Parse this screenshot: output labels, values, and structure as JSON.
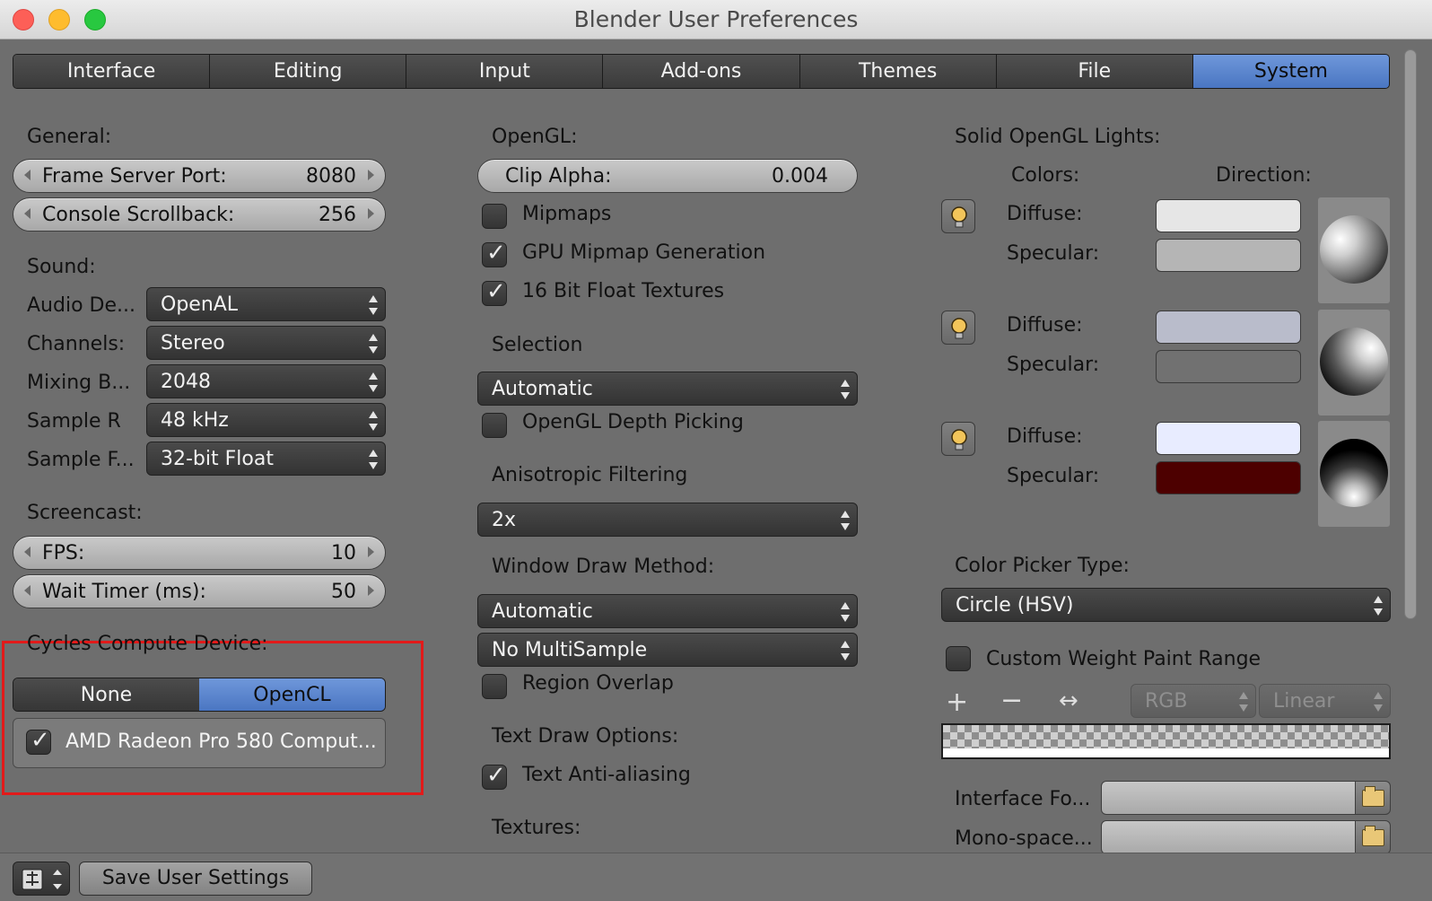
{
  "window": {
    "title": "Blender User Preferences"
  },
  "tabs": [
    {
      "label": "Interface"
    },
    {
      "label": "Editing"
    },
    {
      "label": "Input"
    },
    {
      "label": "Add-ons"
    },
    {
      "label": "Themes"
    },
    {
      "label": "File"
    },
    {
      "label": "System"
    }
  ],
  "active_tab": "System",
  "general": {
    "heading": "General:",
    "frame_server_port": {
      "label": "Frame Server Port:",
      "value": "8080"
    },
    "console_scrollback": {
      "label": "Console Scrollback:",
      "value": "256"
    }
  },
  "sound": {
    "heading": "Sound:",
    "rows": [
      {
        "label": "Audio De...",
        "value": "OpenAL"
      },
      {
        "label": "Channels:",
        "value": "Stereo"
      },
      {
        "label": "Mixing B...",
        "value": "2048"
      },
      {
        "label": "Sample R",
        "value": "48 kHz"
      },
      {
        "label": "Sample F...",
        "value": "32-bit Float"
      }
    ]
  },
  "screencast": {
    "heading": "Screencast:",
    "fps": {
      "label": "FPS:",
      "value": "10"
    },
    "wait_timer": {
      "label": "Wait Timer (ms):",
      "value": "50"
    }
  },
  "cycles": {
    "heading": "Cycles Compute Device:",
    "options": [
      "None",
      "OpenCL"
    ],
    "selected": "OpenCL",
    "device_label": "AMD Radeon Pro 580 Comput...",
    "device_checked": true
  },
  "opengl": {
    "heading": "OpenGL:",
    "clip_alpha": {
      "label": "Clip Alpha:",
      "value": "0.004"
    },
    "mipmaps": {
      "label": "Mipmaps",
      "checked": false
    },
    "gpu_mipmap": {
      "label": "GPU Mipmap Generation",
      "checked": true
    },
    "float_textures": {
      "label": "16 Bit Float Textures",
      "checked": true
    }
  },
  "selection": {
    "heading": "Selection",
    "value": "Automatic",
    "depth_picking": {
      "label": "OpenGL Depth Picking",
      "checked": false
    }
  },
  "anisotropic": {
    "heading": "Anisotropic Filtering",
    "value": "2x"
  },
  "window_draw": {
    "heading": "Window Draw Method:",
    "value": "Automatic",
    "multisample": "No MultiSample",
    "region_overlap": {
      "label": "Region Overlap",
      "checked": false
    }
  },
  "text_draw": {
    "heading": "Text Draw Options:",
    "anti_aliasing": {
      "label": "Text Anti-aliasing",
      "checked": true
    }
  },
  "textures": {
    "heading": "Textures:"
  },
  "lights": {
    "heading": "Solid OpenGL Lights:",
    "colors_label": "Colors:",
    "direction_label": "Direction:",
    "items": [
      {
        "diffuse_label": "Diffuse:",
        "specular_label": "Specular:",
        "diffuse_color": "#e6e6e6",
        "specular_color": "#b5b5b5"
      },
      {
        "diffuse_label": "Diffuse:",
        "specular_label": "Specular:",
        "diffuse_color": "#b9bccb",
        "specular_color": "#717171"
      },
      {
        "diffuse_label": "Diffuse:",
        "specular_label": "Specular:",
        "diffuse_color": "#e8ecff",
        "specular_color": "#4d0000"
      }
    ]
  },
  "color_picker": {
    "heading": "Color Picker Type:",
    "value": "Circle (HSV)"
  },
  "weight_paint": {
    "label": "Custom Weight Paint Range",
    "checked": false,
    "color_mode": "RGB",
    "interpolation": "Linear"
  },
  "fonts": {
    "interface_label": "Interface Fo...",
    "mono_label": "Mono-space..."
  },
  "footer": {
    "save_label": "Save User Settings"
  },
  "colors": {
    "accent": "#4a76c2",
    "panel_bg": "#6e6e6e",
    "highlight_border": "#e21a1a"
  }
}
